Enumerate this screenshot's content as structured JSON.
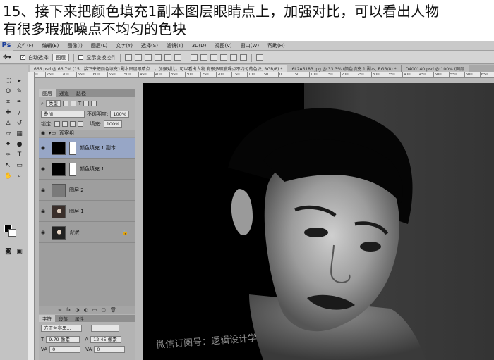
{
  "caption": {
    "line1": "15、接下来把颜色填充1副本图层眼睛点上，加强对比，可以看出人物",
    "line2": "有很多瑕疵噪点不均匀的色块"
  },
  "app": {
    "logo": "Ps",
    "menu": [
      "文件(F)",
      "编辑(E)",
      "图像(I)",
      "图层(L)",
      "文字(Y)",
      "选择(S)",
      "滤镜(T)",
      "3D(D)",
      "视图(V)",
      "窗口(W)",
      "帮助(H)"
    ]
  },
  "options": {
    "auto_select_label": "自动选择:",
    "auto_select_value": "图层",
    "show_transform_label": "显示变换控件"
  },
  "doc_tabs": [
    "666.psd @ 66.7% (15、接下来把颜色填充1副本图层眼睛点上，加强对比，可以看出人物 有很多瑕疵噪点不均匀的色块, RGB/8) *",
    "6L2A6183.jpg @ 33.3% (颜色填充 1 副本, RGB/8) *",
    "D400140.psd @ 100% (图层"
  ],
  "ruler": [
    "800",
    "750",
    "700",
    "650",
    "600",
    "550",
    "500",
    "450",
    "400",
    "350",
    "300",
    "250",
    "200",
    "150",
    "100",
    "50",
    "0",
    "50",
    "100",
    "150",
    "200",
    "250",
    "300",
    "350",
    "400",
    "450",
    "500",
    "550",
    "600",
    "650"
  ],
  "layers_panel": {
    "tabs": [
      "图层",
      "通道",
      "路径"
    ],
    "filter_kind": "类型",
    "blend_mode": "叠加",
    "opacity_label": "不透明度:",
    "opacity_value": "100%",
    "lock_label": "锁定:",
    "fill_label": "填充:",
    "fill_value": "100%",
    "group_name": "观察组",
    "layers": [
      {
        "name": "颜色填充 1 副本",
        "selected": true
      },
      {
        "name": "颜色填充 1",
        "selected": false
      },
      {
        "name": "图层 2",
        "selected": false
      },
      {
        "name": "图层 1",
        "selected": false
      },
      {
        "name": "背景",
        "selected": false
      }
    ],
    "footer_icons": [
      "∞",
      "fx",
      "◑",
      "◐",
      "▭",
      "▢",
      "🗑"
    ]
  },
  "character_panel": {
    "tabs": [
      "字符",
      "段落",
      "属性"
    ],
    "font_family": "方正兰亭黑...",
    "font_size": "9.79 像素",
    "leading": "12.45 像素",
    "tracking": "0",
    "kerning": "0"
  },
  "canvas": {
    "watermark": "微信订阅号：逻辑设计学"
  }
}
